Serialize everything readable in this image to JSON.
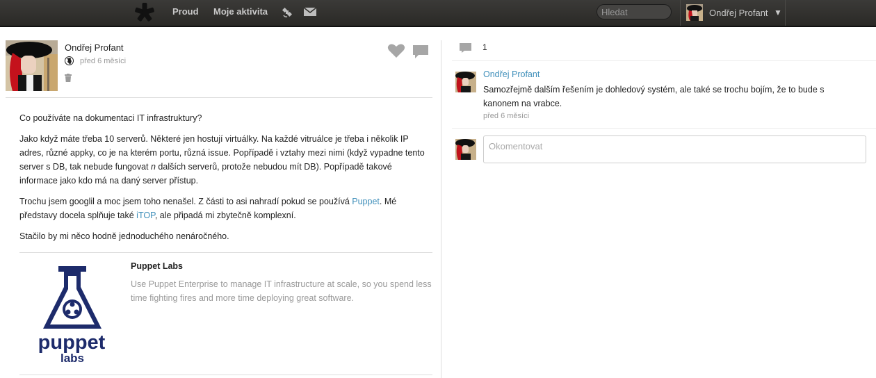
{
  "header": {
    "nav": {
      "stream": "Proud",
      "activity": "Moje aktivita"
    },
    "search_placeholder": "Hledat",
    "user_name": "Ondřej Profant",
    "caret": "▼",
    "icons": [
      "asterisk-logo-icon",
      "satellite-icon",
      "mail-icon"
    ]
  },
  "post": {
    "author": "Ondřej Profant",
    "time": "před 6 měsíci",
    "paragraphs": {
      "p1": "Co používáte na dokumentaci IT infrastruktury?",
      "p2_a": "Jako když máte třeba 10 serverů. Některé jen hostují virtuálky. Na každé vitruálce je třeba i několik IP adres, různé appky, co je na kterém portu, různá issue. Popřípadě i vztahy mezi nimi (když vypadne tento server s DB, tak nebude fungovat ",
      "p2_em": "n",
      "p2_b": " dalších serverů, protože nebudou mít DB). Popřípadě takové informace jako kdo má na daný server přístup.",
      "p3_a": "Trochu jsem googlil a moc jsem toho nenašel. Z části to asi nahradí pokud se používá ",
      "p3_link1": "Puppet",
      "p3_b": ". Mé představy docela splňuje také ",
      "p3_link2": "iTOP",
      "p3_c": ", ale připadá mi zbytečně komplexní.",
      "p4": "Stačilo by mi něco hodně jednoduchého nenáročného."
    },
    "og": {
      "title": "Puppet Labs",
      "description": "Use Puppet Enterprise to manage IT infrastructure at scale, so you spend less time fighting fires and more time deploying great software.",
      "logo_text_1": "puppet",
      "logo_text_2": "labs"
    }
  },
  "comments": {
    "count": "1",
    "items": [
      {
        "author": "Ondřej Profant",
        "text": "Samozřejmě dalším řešením je dohledový systém, ale také se trochu bojím, že to bude s kanonem na vrabce.",
        "time": "před 6 měsíci"
      }
    ],
    "placeholder": "Okomentovat"
  },
  "colors": {
    "link": "#3f8fba",
    "puppet_navy": "#1d2b6b",
    "topbar": "#2f2e2b"
  }
}
